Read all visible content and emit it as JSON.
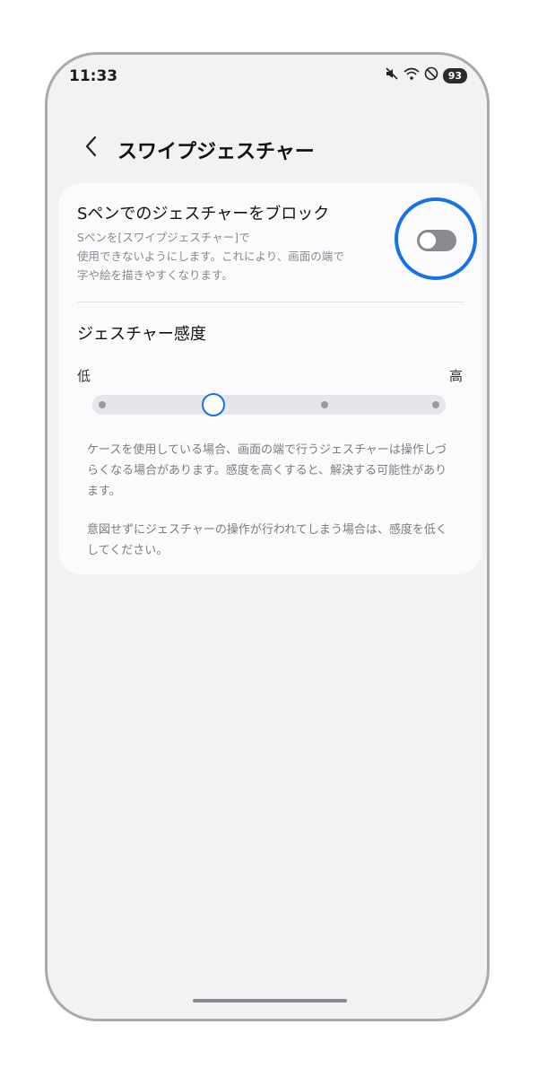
{
  "status_bar": {
    "time": "11:33",
    "battery": "93",
    "icons": [
      "mute-icon",
      "wifi-icon",
      "do-not-disturb-icon"
    ]
  },
  "header": {
    "back_icon": "chevron-left-icon",
    "title": "スワイプジェスチャー"
  },
  "block_spen": {
    "title": "Sペンでのジェスチャーをブロック",
    "description": "Sペンを[スワイプジェスチャー]で\n使用できないようにします。これにより、画面の端で\n字や絵を描きやすくなります。",
    "toggle_on": false
  },
  "sensitivity": {
    "title": "ジェスチャー感度",
    "low_label": "低",
    "high_label": "高",
    "steps": 4,
    "selected_step": 2
  },
  "notes": {
    "note1": "ケースを使用している場合、画面の端で行うジェスチャーは操作しづらくなる場合があります。感度を高くすると、解決する可能性があります。",
    "note2": "意図せずにジェスチャーの操作が行われてしまう場合は、感度を低くしてください。"
  },
  "colors": {
    "accent": "#1573e6",
    "background": "#f2f2f4",
    "card": "#fbfbfd"
  }
}
